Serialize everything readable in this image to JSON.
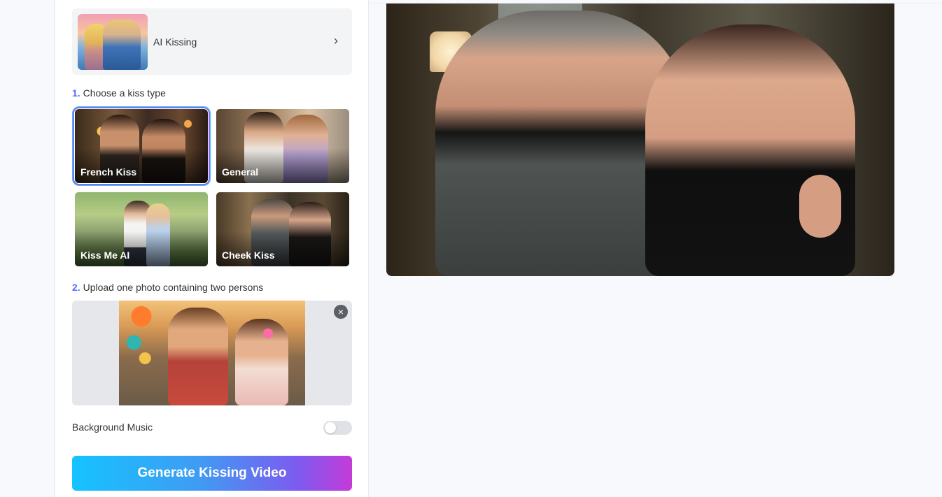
{
  "tool": {
    "title": "AI Kissing",
    "thumbnail_icon": "couple-kiss-image"
  },
  "step1": {
    "number": "1.",
    "label": "Choose a kiss type"
  },
  "kiss_types": [
    {
      "label": "French Kiss",
      "selected": true
    },
    {
      "label": "General",
      "selected": false
    },
    {
      "label": "Kiss Me AI",
      "selected": false
    },
    {
      "label": "Cheek Kiss",
      "selected": false
    }
  ],
  "step2": {
    "number": "2.",
    "label": "Upload one photo containing two persons"
  },
  "upload": {
    "remove_icon": "close-circle-icon",
    "remove_glyph": "×"
  },
  "background_music": {
    "label": "Background Music",
    "enabled": false
  },
  "generate_button": {
    "label": "Generate Kissing Video"
  },
  "colors": {
    "accent_blue": "#4f6ef7",
    "selected_border_start": "#2ad0ff",
    "selected_border_end": "#b14de6",
    "generate_gradient_start": "#15c3ff",
    "generate_gradient_end": "#c43bd8"
  }
}
